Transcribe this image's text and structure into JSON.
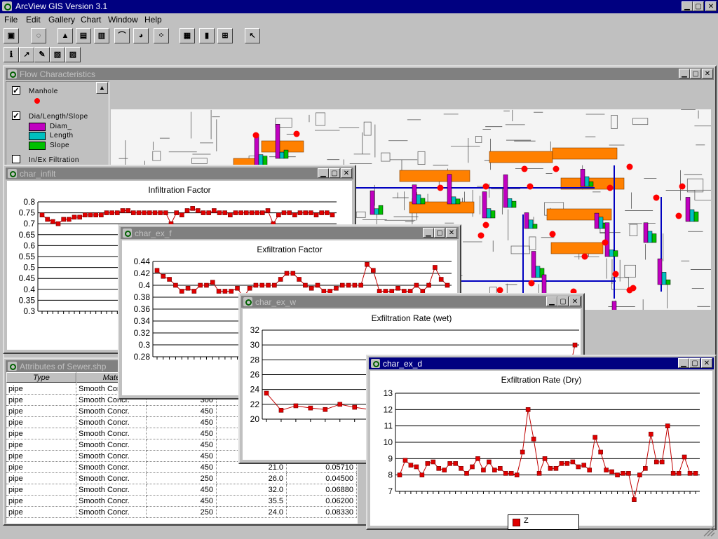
{
  "app": {
    "title": "ArcView GIS Version 3.1",
    "menu": [
      "File",
      "Edit",
      "Gallery",
      "Chart",
      "Window",
      "Help"
    ]
  },
  "view_window": {
    "title": "Flow Characteristics",
    "legend": {
      "manhole": "Manhole",
      "dls": "Dia/Length/Slope",
      "diam": "Diam_",
      "length": "Length",
      "slope": "Slope",
      "inex": "In/Ex Filtration"
    },
    "colors": {
      "manhole": "#ff0000",
      "diam": "#c000c0",
      "length": "#00c0c0",
      "slope": "#00c000",
      "building": "#ff8000",
      "pipe": "#0000c0"
    }
  },
  "table_window": {
    "title": "Attributes of Sewer.shp",
    "headers": [
      "Type",
      "Mate"
    ],
    "rows": [
      [
        "pipe",
        "Smooth Concr.",
        "",
        "",
        ""
      ],
      [
        "pipe",
        "Smooth Concr.",
        "300",
        "",
        ""
      ],
      [
        "pipe",
        "Smooth Concr.",
        "450",
        "",
        ""
      ],
      [
        "pipe",
        "Smooth Concr.",
        "450",
        "",
        ""
      ],
      [
        "pipe",
        "Smooth Concr.",
        "450",
        "",
        ""
      ],
      [
        "pipe",
        "Smooth Concr.",
        "450",
        "",
        ""
      ],
      [
        "pipe",
        "Smooth Concr.",
        "450",
        "",
        ""
      ],
      [
        "pipe",
        "Smooth Concr.",
        "450",
        "21.0",
        "0.05710"
      ],
      [
        "pipe",
        "Smooth Concr.",
        "250",
        "26.0",
        "0.04500"
      ],
      [
        "pipe",
        "Smooth Concr.",
        "450",
        "32.0",
        "0.06880"
      ],
      [
        "pipe",
        "Smooth Concr.",
        "450",
        "35.5",
        "0.06200"
      ],
      [
        "pipe",
        "Smooth Concr.",
        "250",
        "24.0",
        "0.08330"
      ]
    ]
  },
  "chart_data": [
    {
      "window": "char_infilt",
      "type": "line",
      "title": "Infiltration Factor",
      "ylim": [
        0.3,
        0.8
      ],
      "yticks": [
        "0.8",
        "0.75",
        "0.7",
        "0.65",
        "0.6",
        "0.55",
        "0.5",
        "0.45",
        "0.4",
        "0.35",
        "0.3"
      ],
      "values": [
        0.74,
        0.72,
        0.71,
        0.7,
        0.72,
        0.72,
        0.73,
        0.73,
        0.74,
        0.74,
        0.74,
        0.74,
        0.75,
        0.75,
        0.75,
        0.76,
        0.76,
        0.75,
        0.75,
        0.75,
        0.75,
        0.75,
        0.75,
        0.75,
        0.7,
        0.75,
        0.74,
        0.76,
        0.77,
        0.76,
        0.75,
        0.75,
        0.76,
        0.75,
        0.75,
        0.74,
        0.75,
        0.75,
        0.75,
        0.75,
        0.75,
        0.75,
        0.76,
        0.7,
        0.74,
        0.75,
        0.75,
        0.74,
        0.75,
        0.75,
        0.75,
        0.74,
        0.75,
        0.75,
        0.74
      ]
    },
    {
      "window": "char_ex_f",
      "type": "line",
      "title": "Exfiltration Factor",
      "ylim": [
        0.28,
        0.44
      ],
      "yticks": [
        "0.44",
        "0.42",
        "0.4",
        "0.38",
        "0.36",
        "0.34",
        "0.32",
        "0.3",
        "0.28"
      ],
      "values": [
        0.425,
        0.415,
        0.41,
        0.4,
        0.39,
        0.395,
        0.39,
        0.4,
        0.4,
        0.405,
        0.39,
        0.39,
        0.39,
        0.395,
        0.38,
        0.395,
        0.4,
        0.4,
        0.4,
        0.4,
        0.41,
        0.42,
        0.42,
        0.41,
        0.4,
        0.395,
        0.4,
        0.39,
        0.39,
        0.395,
        0.4,
        0.4,
        0.4,
        0.4,
        0.435,
        0.425,
        0.39,
        0.39,
        0.39,
        0.395,
        0.39,
        0.39,
        0.4,
        0.39,
        0.4,
        0.43,
        0.41,
        0.4
      ]
    },
    {
      "window": "char_ex_w",
      "type": "line",
      "title": "Exfiltration Rate (wet)",
      "ylim": [
        20,
        32
      ],
      "yticks": [
        "32",
        "30",
        "28",
        "26",
        "24",
        "22",
        "20"
      ],
      "values": [
        23.5,
        21.2,
        21.8,
        21.5,
        21.3,
        22.0,
        21.6,
        21.3,
        21.5,
        20.8,
        21.5,
        21.7,
        20.0,
        20.0,
        21.0,
        22.5,
        21.0,
        20.3,
        21.5,
        20.5,
        21.0,
        30.0
      ]
    },
    {
      "window": "char_ex_d",
      "type": "line",
      "title": "Exfiltration  Rate (Dry)",
      "ylim": [
        7,
        13
      ],
      "yticks": [
        "13",
        "12",
        "11",
        "10",
        "9",
        "8",
        "7"
      ],
      "legend": [
        "Z"
      ],
      "values": [
        8.0,
        8.9,
        8.6,
        8.5,
        8.0,
        8.7,
        8.8,
        8.4,
        8.3,
        8.7,
        8.7,
        8.4,
        8.1,
        8.5,
        9.0,
        8.3,
        8.8,
        8.3,
        8.4,
        8.1,
        8.1,
        8.0,
        9.4,
        12.0,
        10.2,
        8.1,
        9.0,
        8.4,
        8.4,
        8.7,
        8.7,
        8.8,
        8.5,
        8.6,
        8.3,
        10.3,
        9.4,
        8.3,
        8.2,
        8.0,
        8.1,
        8.1,
        6.5,
        8.0,
        8.4,
        10.5,
        8.8,
        8.8,
        11.0,
        8.1,
        8.1,
        9.1,
        8.1,
        8.1
      ]
    }
  ]
}
